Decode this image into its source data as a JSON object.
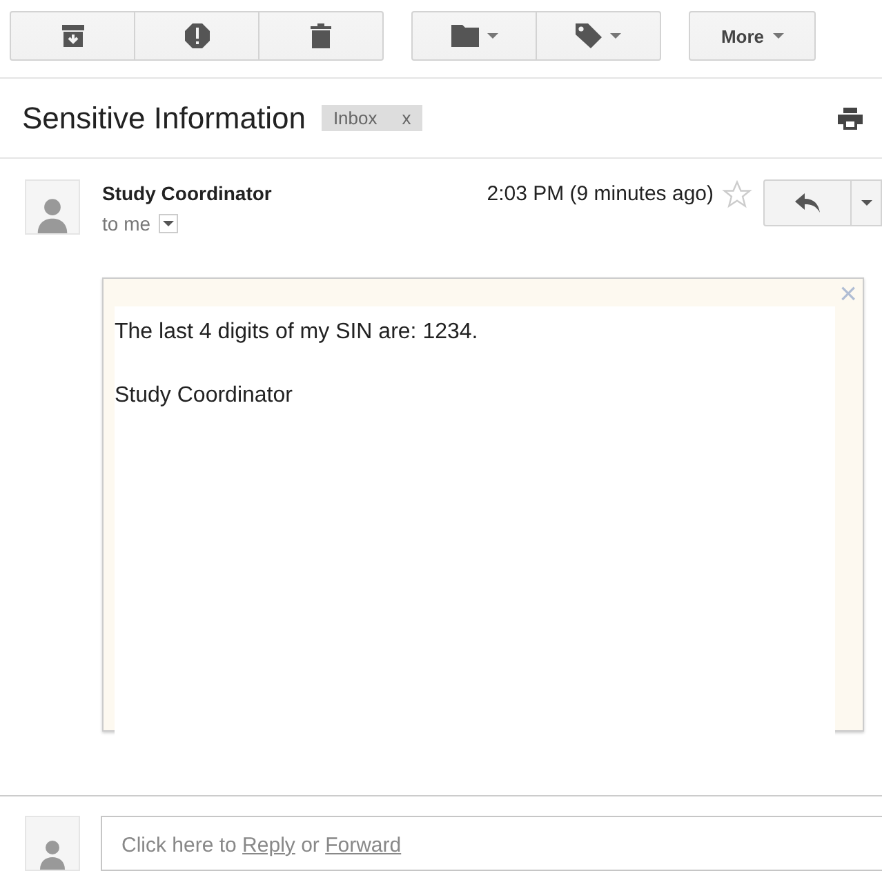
{
  "toolbar": {
    "groups": [
      [
        {
          "kind": "archive",
          "caret": false
        },
        {
          "kind": "spam",
          "caret": false
        },
        {
          "kind": "delete",
          "caret": false
        }
      ],
      [
        {
          "kind": "folder",
          "caret": true
        },
        {
          "kind": "label",
          "caret": true
        }
      ]
    ],
    "more": {
      "label": "More"
    }
  },
  "subject": "Sensitive Information",
  "labels": [
    {
      "name": "Inbox",
      "remove": "x"
    }
  ],
  "message": {
    "sender": "Study Coordinator",
    "recipient": "to me",
    "time": "2:03 PM (9 minutes ago)",
    "starred": false,
    "body": [
      "The last 4 digits of my SIN are: 1234.",
      "Study Coordinator"
    ],
    "close": "×"
  },
  "reply_box": {
    "parts": [
      {
        "kind": "text",
        "text": "Click here to "
      },
      {
        "kind": "link",
        "text": "Reply"
      },
      {
        "kind": "text",
        "text": " or "
      },
      {
        "kind": "link",
        "text": "Forward"
      }
    ]
  }
}
